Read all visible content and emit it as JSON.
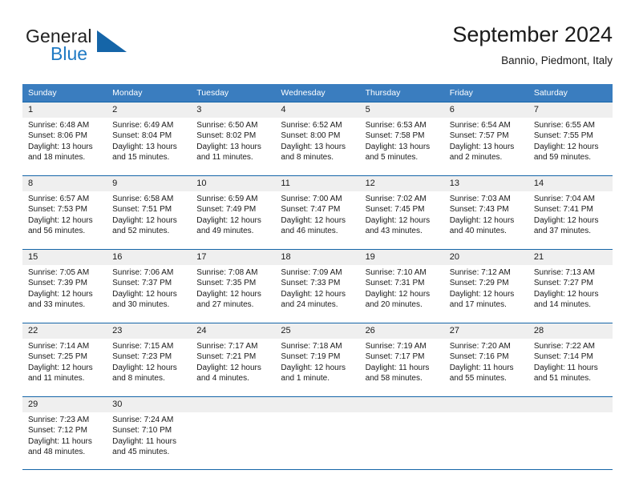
{
  "logo": {
    "word_one": "General",
    "word_two": "Blue",
    "accent_color": "#1565a8"
  },
  "header": {
    "title": "September 2024",
    "subtitle": "Bannio, Piedmont, Italy"
  },
  "calendar": {
    "header_bg": "#3a7dbf",
    "rule_color": "#1565a8",
    "daynum_bg": "#efefef",
    "weekdays": [
      "Sunday",
      "Monday",
      "Tuesday",
      "Wednesday",
      "Thursday",
      "Friday",
      "Saturday"
    ],
    "weeks": [
      [
        {
          "day": "1",
          "sunrise": "Sunrise: 6:48 AM",
          "sunset": "Sunset: 8:06 PM",
          "daylight": "Daylight: 13 hours and 18 minutes."
        },
        {
          "day": "2",
          "sunrise": "Sunrise: 6:49 AM",
          "sunset": "Sunset: 8:04 PM",
          "daylight": "Daylight: 13 hours and 15 minutes."
        },
        {
          "day": "3",
          "sunrise": "Sunrise: 6:50 AM",
          "sunset": "Sunset: 8:02 PM",
          "daylight": "Daylight: 13 hours and 11 minutes."
        },
        {
          "day": "4",
          "sunrise": "Sunrise: 6:52 AM",
          "sunset": "Sunset: 8:00 PM",
          "daylight": "Daylight: 13 hours and 8 minutes."
        },
        {
          "day": "5",
          "sunrise": "Sunrise: 6:53 AM",
          "sunset": "Sunset: 7:58 PM",
          "daylight": "Daylight: 13 hours and 5 minutes."
        },
        {
          "day": "6",
          "sunrise": "Sunrise: 6:54 AM",
          "sunset": "Sunset: 7:57 PM",
          "daylight": "Daylight: 13 hours and 2 minutes."
        },
        {
          "day": "7",
          "sunrise": "Sunrise: 6:55 AM",
          "sunset": "Sunset: 7:55 PM",
          "daylight": "Daylight: 12 hours and 59 minutes."
        }
      ],
      [
        {
          "day": "8",
          "sunrise": "Sunrise: 6:57 AM",
          "sunset": "Sunset: 7:53 PM",
          "daylight": "Daylight: 12 hours and 56 minutes."
        },
        {
          "day": "9",
          "sunrise": "Sunrise: 6:58 AM",
          "sunset": "Sunset: 7:51 PM",
          "daylight": "Daylight: 12 hours and 52 minutes."
        },
        {
          "day": "10",
          "sunrise": "Sunrise: 6:59 AM",
          "sunset": "Sunset: 7:49 PM",
          "daylight": "Daylight: 12 hours and 49 minutes."
        },
        {
          "day": "11",
          "sunrise": "Sunrise: 7:00 AM",
          "sunset": "Sunset: 7:47 PM",
          "daylight": "Daylight: 12 hours and 46 minutes."
        },
        {
          "day": "12",
          "sunrise": "Sunrise: 7:02 AM",
          "sunset": "Sunset: 7:45 PM",
          "daylight": "Daylight: 12 hours and 43 minutes."
        },
        {
          "day": "13",
          "sunrise": "Sunrise: 7:03 AM",
          "sunset": "Sunset: 7:43 PM",
          "daylight": "Daylight: 12 hours and 40 minutes."
        },
        {
          "day": "14",
          "sunrise": "Sunrise: 7:04 AM",
          "sunset": "Sunset: 7:41 PM",
          "daylight": "Daylight: 12 hours and 37 minutes."
        }
      ],
      [
        {
          "day": "15",
          "sunrise": "Sunrise: 7:05 AM",
          "sunset": "Sunset: 7:39 PM",
          "daylight": "Daylight: 12 hours and 33 minutes."
        },
        {
          "day": "16",
          "sunrise": "Sunrise: 7:06 AM",
          "sunset": "Sunset: 7:37 PM",
          "daylight": "Daylight: 12 hours and 30 minutes."
        },
        {
          "day": "17",
          "sunrise": "Sunrise: 7:08 AM",
          "sunset": "Sunset: 7:35 PM",
          "daylight": "Daylight: 12 hours and 27 minutes."
        },
        {
          "day": "18",
          "sunrise": "Sunrise: 7:09 AM",
          "sunset": "Sunset: 7:33 PM",
          "daylight": "Daylight: 12 hours and 24 minutes."
        },
        {
          "day": "19",
          "sunrise": "Sunrise: 7:10 AM",
          "sunset": "Sunset: 7:31 PM",
          "daylight": "Daylight: 12 hours and 20 minutes."
        },
        {
          "day": "20",
          "sunrise": "Sunrise: 7:12 AM",
          "sunset": "Sunset: 7:29 PM",
          "daylight": "Daylight: 12 hours and 17 minutes."
        },
        {
          "day": "21",
          "sunrise": "Sunrise: 7:13 AM",
          "sunset": "Sunset: 7:27 PM",
          "daylight": "Daylight: 12 hours and 14 minutes."
        }
      ],
      [
        {
          "day": "22",
          "sunrise": "Sunrise: 7:14 AM",
          "sunset": "Sunset: 7:25 PM",
          "daylight": "Daylight: 12 hours and 11 minutes."
        },
        {
          "day": "23",
          "sunrise": "Sunrise: 7:15 AM",
          "sunset": "Sunset: 7:23 PM",
          "daylight": "Daylight: 12 hours and 8 minutes."
        },
        {
          "day": "24",
          "sunrise": "Sunrise: 7:17 AM",
          "sunset": "Sunset: 7:21 PM",
          "daylight": "Daylight: 12 hours and 4 minutes."
        },
        {
          "day": "25",
          "sunrise": "Sunrise: 7:18 AM",
          "sunset": "Sunset: 7:19 PM",
          "daylight": "Daylight: 12 hours and 1 minute."
        },
        {
          "day": "26",
          "sunrise": "Sunrise: 7:19 AM",
          "sunset": "Sunset: 7:17 PM",
          "daylight": "Daylight: 11 hours and 58 minutes."
        },
        {
          "day": "27",
          "sunrise": "Sunrise: 7:20 AM",
          "sunset": "Sunset: 7:16 PM",
          "daylight": "Daylight: 11 hours and 55 minutes."
        },
        {
          "day": "28",
          "sunrise": "Sunrise: 7:22 AM",
          "sunset": "Sunset: 7:14 PM",
          "daylight": "Daylight: 11 hours and 51 minutes."
        }
      ],
      [
        {
          "day": "29",
          "sunrise": "Sunrise: 7:23 AM",
          "sunset": "Sunset: 7:12 PM",
          "daylight": "Daylight: 11 hours and 48 minutes."
        },
        {
          "day": "30",
          "sunrise": "Sunrise: 7:24 AM",
          "sunset": "Sunset: 7:10 PM",
          "daylight": "Daylight: 11 hours and 45 minutes."
        },
        {
          "day": "",
          "sunrise": "",
          "sunset": "",
          "daylight": ""
        },
        {
          "day": "",
          "sunrise": "",
          "sunset": "",
          "daylight": ""
        },
        {
          "day": "",
          "sunrise": "",
          "sunset": "",
          "daylight": ""
        },
        {
          "day": "",
          "sunrise": "",
          "sunset": "",
          "daylight": ""
        },
        {
          "day": "",
          "sunrise": "",
          "sunset": "",
          "daylight": ""
        }
      ]
    ]
  }
}
